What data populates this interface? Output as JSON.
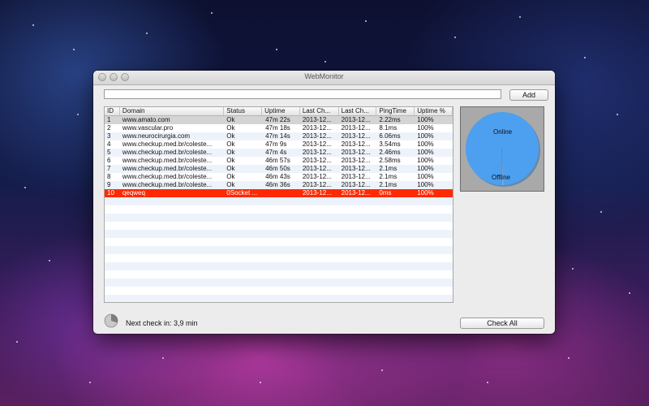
{
  "window": {
    "title": "WebMonitor"
  },
  "toolbar": {
    "url_value": "",
    "add_label": "Add"
  },
  "table": {
    "columns": [
      "ID",
      "Domain",
      "Status",
      "Uptime",
      "Last Ch...",
      "Last Ch...",
      "PingTime",
      "Uptime %"
    ],
    "rows": [
      [
        "1",
        "www.amato.com",
        "Ok",
        "47m 22s",
        "2013-12...",
        "2013-12...",
        "2.22ms",
        "100%"
      ],
      [
        "2",
        "www.vascular.pro",
        "Ok",
        "47m 18s",
        "2013-12...",
        "2013-12...",
        "8.1ms",
        "100%"
      ],
      [
        "3",
        "www.neurocirurgia.com",
        "Ok",
        "47m 14s",
        "2013-12...",
        "2013-12...",
        "6.06ms",
        "100%"
      ],
      [
        "4",
        "www.checkup.med.br/coleste...",
        "Ok",
        "47m 9s",
        "2013-12...",
        "2013-12...",
        "3.54ms",
        "100%"
      ],
      [
        "5",
        "www.checkup.med.br/coleste...",
        "Ok",
        "47m 4s",
        "2013-12...",
        "2013-12...",
        "2.46ms",
        "100%"
      ],
      [
        "6",
        "www.checkup.med.br/coleste...",
        "Ok",
        "46m 57s",
        "2013-12...",
        "2013-12...",
        "2.58ms",
        "100%"
      ],
      [
        "7",
        "www.checkup.med.br/coleste...",
        "Ok",
        "46m 50s",
        "2013-12...",
        "2013-12...",
        "2.1ms",
        "100%"
      ],
      [
        "8",
        "www.checkup.med.br/coleste...",
        "Ok",
        "46m 43s",
        "2013-12...",
        "2013-12...",
        "2.1ms",
        "100%"
      ],
      [
        "9",
        "www.checkup.med.br/coleste...",
        "Ok",
        "46m 36s",
        "2013-12...",
        "2013-12...",
        "2.1ms",
        "100%"
      ],
      [
        "10",
        "qeqweq",
        "0Socket ...",
        "",
        "2013-12...",
        "2013-12...",
        "0ms",
        "100%"
      ]
    ]
  },
  "status_chart": {
    "online_label": "Online",
    "offline_label": "Offline",
    "online_fraction": 0.995,
    "online_color": "#4d9ff0",
    "panel_color": "#a9a9a9"
  },
  "footer": {
    "next_check_text": "Next check in: 3,9 min",
    "check_all_label": "Check All",
    "countdown_icon": "pie-timer-icon"
  },
  "colors": {
    "error_row": "#ff2a00",
    "selected_row": "#d4d4d4",
    "alt_row": "#eef3fb"
  }
}
